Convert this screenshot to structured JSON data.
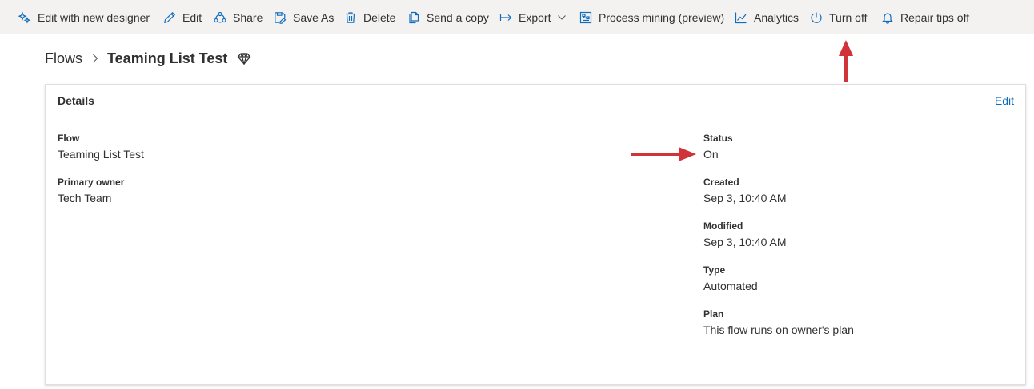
{
  "toolbar": {
    "items": [
      {
        "label": "Edit with new designer",
        "icon": "designer-sparkle-icon"
      },
      {
        "label": "Edit",
        "icon": "pencil-icon"
      },
      {
        "label": "Share",
        "icon": "share-people-icon"
      },
      {
        "label": "Save As",
        "icon": "save-as-icon"
      },
      {
        "label": "Delete",
        "icon": "trash-icon"
      },
      {
        "label": "Send a copy",
        "icon": "copy-icon"
      },
      {
        "label": "Export",
        "icon": "export-arrow-icon"
      },
      {
        "label": "Process mining (preview)",
        "icon": "process-mining-icon"
      },
      {
        "label": "Analytics",
        "icon": "analytics-chart-icon"
      },
      {
        "label": "Turn off",
        "icon": "power-icon"
      },
      {
        "label": "Repair tips off",
        "icon": "bell-icon"
      }
    ]
  },
  "breadcrumb": {
    "root": "Flows",
    "current": "Teaming List Test",
    "premium_icon": "diamond-icon"
  },
  "details": {
    "title": "Details",
    "edit_label": "Edit",
    "left": [
      {
        "label": "Flow",
        "value": "Teaming List Test"
      },
      {
        "label": "Primary owner",
        "value": "Tech Team"
      }
    ],
    "right": [
      {
        "label": "Status",
        "value": "On"
      },
      {
        "label": "Created",
        "value": "Sep 3, 10:40 AM"
      },
      {
        "label": "Modified",
        "value": "Sep 3, 10:40 AM"
      },
      {
        "label": "Type",
        "value": "Automated"
      },
      {
        "label": "Plan",
        "value": "This flow runs on owner's plan"
      }
    ]
  },
  "colors": {
    "toolbar_bg": "#f3f2f1",
    "icon_blue": "#0f6cbd",
    "annotation_arrow": "#d13438"
  }
}
